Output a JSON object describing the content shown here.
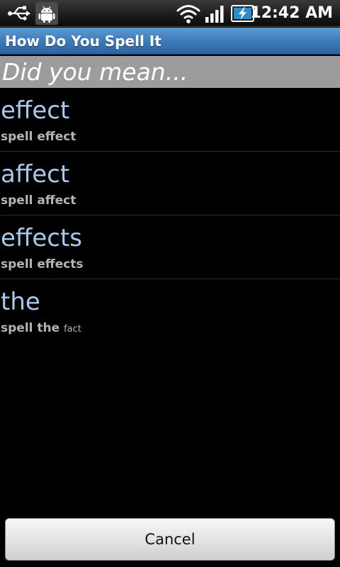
{
  "status_bar": {
    "time": "12:42 AM",
    "icons": [
      "usb-icon",
      "android-debug-icon",
      "wifi-icon",
      "signal-icon",
      "battery-charging-icon"
    ]
  },
  "app": {
    "title": "How Do You Spell It"
  },
  "dialog": {
    "header": "Did you mean..."
  },
  "suggestions": [
    {
      "word": "effect",
      "subtitle": "spell effect",
      "extra": ""
    },
    {
      "word": "affect",
      "subtitle": "spell affect",
      "extra": ""
    },
    {
      "word": "effects",
      "subtitle": "spell effects",
      "extra": ""
    },
    {
      "word": "the",
      "subtitle": "spell the",
      "extra": "fact"
    }
  ],
  "buttons": {
    "cancel_label": "Cancel"
  },
  "colors": {
    "title_bar": "#3a78b8",
    "header_band": "#9c9c9c",
    "suggestion_word": "#a8c8ec",
    "subtitle": "#b4b4b4"
  }
}
